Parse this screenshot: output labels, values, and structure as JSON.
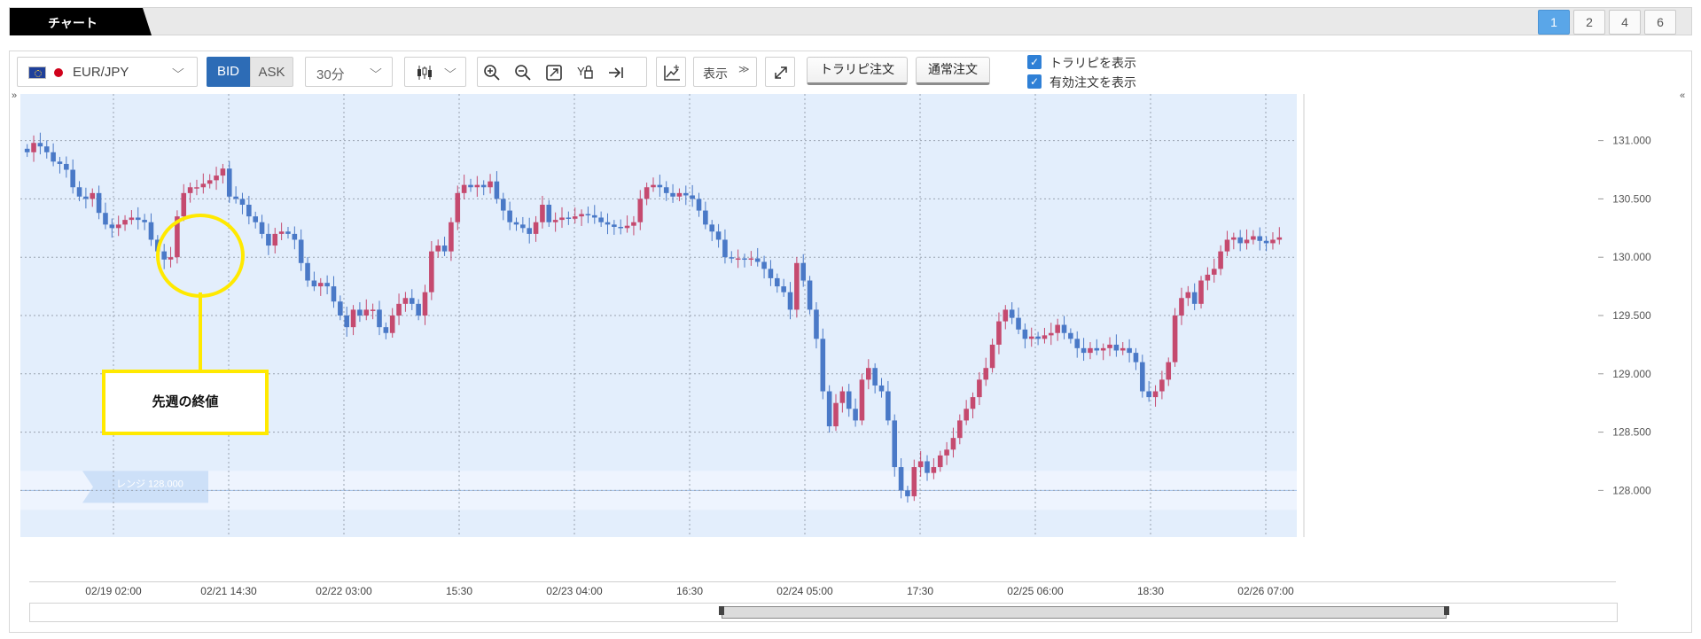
{
  "tabs": {
    "chart_label": "チャート"
  },
  "layout_buttons": [
    {
      "label": "1",
      "active": true
    },
    {
      "label": "2",
      "active": false
    },
    {
      "label": "4",
      "active": false
    },
    {
      "label": "6",
      "active": false
    }
  ],
  "toolbar": {
    "pair": "EUR/JPY",
    "bid_label": "BID",
    "ask_label": "ASK",
    "interval": "30分",
    "display_label": "表示",
    "trap_order_label": "トラリピ注文",
    "normal_order_label": "通常注文",
    "show_trap_label": "トラリピを表示",
    "show_orders_label": "有効注文を表示",
    "show_trap_checked": true,
    "show_orders_checked": true,
    "icons": [
      "candlestick-icon",
      "zoom-in-icon",
      "zoom-out-icon",
      "fit-icon",
      "y-axis-lock-icon",
      "scroll-to-end-icon",
      "indicator-add-icon",
      "fullscreen-icon"
    ]
  },
  "annotation": {
    "label": "先週の終値"
  },
  "range_label": "レンジ 128.000",
  "colors": {
    "up": "#c54a6f",
    "down": "#4a79c7",
    "plot_bg": "#e3eefc",
    "annotation": "#ffe900",
    "active_tab": "#5aa6e8"
  },
  "chart_data": {
    "type": "candlestick",
    "y_ticks": [
      "131.000",
      "130.500",
      "130.000",
      "129.500",
      "129.000",
      "128.500",
      "128.000"
    ],
    "y_tick_values": [
      131.0,
      130.5,
      130.0,
      129.5,
      129.0,
      128.5,
      128.0
    ],
    "ylim": [
      127.6,
      131.4
    ],
    "x_ticks": [
      "02/19 02:00",
      "02/21 14:30",
      "02/22 03:00",
      "15:30",
      "02/23 04:00",
      "16:30",
      "02/24 05:00",
      "17:30",
      "02/25 06:00",
      "18:30",
      "02/26 07:00"
    ],
    "range_line": 128.0,
    "grid": true,
    "close_path": [
      130.9,
      130.98,
      130.95,
      130.9,
      130.82,
      130.8,
      130.75,
      130.6,
      130.52,
      130.5,
      130.55,
      130.38,
      130.28,
      130.25,
      130.28,
      130.32,
      130.34,
      130.32,
      130.3,
      130.15,
      130.05,
      129.98,
      130.0,
      130.35,
      130.55,
      130.6,
      130.6,
      130.63,
      130.66,
      130.7,
      130.76,
      130.52,
      130.5,
      130.45,
      130.35,
      130.3,
      130.2,
      130.1,
      130.2,
      130.22,
      130.2,
      130.15,
      129.95,
      129.8,
      129.75,
      129.78,
      129.75,
      129.62,
      129.5,
      129.4,
      129.55,
      129.5,
      129.55,
      129.55,
      129.4,
      129.35,
      129.5,
      129.6,
      129.65,
      129.6,
      129.5,
      129.7,
      130.05,
      130.1,
      130.05,
      130.3,
      130.55,
      130.62,
      130.6,
      130.62,
      130.6,
      130.65,
      130.5,
      130.4,
      130.3,
      130.28,
      130.25,
      130.2,
      130.3,
      130.45,
      130.3,
      130.32,
      130.34,
      130.33,
      130.35,
      130.37,
      130.36,
      130.34,
      130.3,
      130.28,
      130.26,
      130.25,
      130.27,
      130.3,
      130.5,
      130.6,
      130.62,
      130.6,
      130.55,
      130.52,
      130.55,
      130.53,
      130.5,
      130.4,
      130.28,
      130.22,
      130.15,
      130.0,
      129.99,
      129.99,
      129.98,
      129.99,
      129.96,
      129.9,
      129.82,
      129.75,
      129.7,
      129.55,
      129.95,
      129.8,
      129.55,
      129.3,
      128.85,
      128.55,
      128.75,
      128.85,
      128.7,
      128.6,
      128.95,
      129.05,
      128.9,
      128.85,
      128.6,
      128.2,
      128.0,
      127.95,
      128.2,
      128.25,
      128.15,
      128.2,
      128.3,
      128.35,
      128.45,
      128.6,
      128.7,
      128.8,
      128.95,
      129.05,
      129.25,
      129.45,
      129.55,
      129.48,
      129.38,
      129.3,
      129.32,
      129.3,
      129.33,
      129.35,
      129.42,
      129.35,
      129.3,
      129.22,
      129.18,
      129.22,
      129.2,
      129.22,
      129.25,
      129.2,
      129.22,
      129.18,
      129.1,
      128.85,
      128.8,
      128.85,
      128.95,
      129.1,
      129.5,
      129.65,
      129.7,
      129.6,
      129.8,
      129.85,
      129.9,
      130.05,
      130.15,
      130.17,
      130.12,
      130.15,
      130.18,
      130.14,
      130.12,
      130.15,
      130.17
    ]
  }
}
